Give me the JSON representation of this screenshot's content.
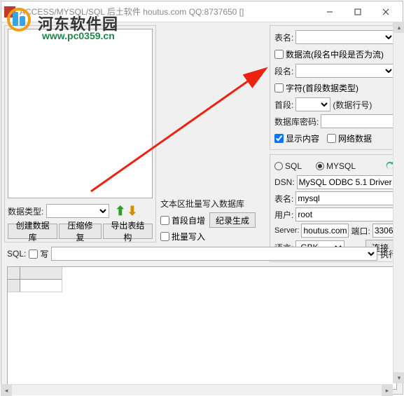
{
  "titlebar": {
    "title": "ACCESS/MYSQL/SQL 后土软件 houtus.com QQ:8737650 []"
  },
  "watermark": {
    "text": "河东软件园",
    "url": "www.pc0359.cn"
  },
  "left": {
    "dataTypeLabel": "数据类型:",
    "btnCreateDb": "创建数据库",
    "btnCompress": "压缩修复",
    "btnExport": "导出表结构"
  },
  "mid": {
    "batchLabel": "文本区批量写入数据库",
    "autoInc": "首段自增",
    "batchWrite": "批量写入",
    "genRecord": "纪录生成"
  },
  "rightTop": {
    "tableNameLabel": "表名:",
    "dataFlow": "数据流(段名中段是否为流)",
    "fieldNameLabel": "段名:",
    "charType": "字符(首段数据类型)",
    "firstFieldLabel": "首段:",
    "dataRowNo": "(数据行号)",
    "dbPasswordLabel": "数据库密码:",
    "showContent": "显示内容",
    "networkData": "网络数据"
  },
  "conn": {
    "sqlOpt": "SQL",
    "mysqlOpt": "MYSQL",
    "dsnLabel": "DSN:",
    "dsnValue": "MySQL ODBC 5.1 Driver",
    "tableLabel": "表名:",
    "tableValue": "mysql",
    "userLabel": "用户:",
    "userValue": "root",
    "serverLabel": "Server:",
    "serverValue": "houtus.com",
    "portLabel": "端口:",
    "portValue": "3306",
    "langLabel": "语言:",
    "langValue": "GBK",
    "connectBtn": "连接"
  },
  "sql": {
    "label": "SQL:",
    "writeChk": "写",
    "execBtn": "执行"
  }
}
